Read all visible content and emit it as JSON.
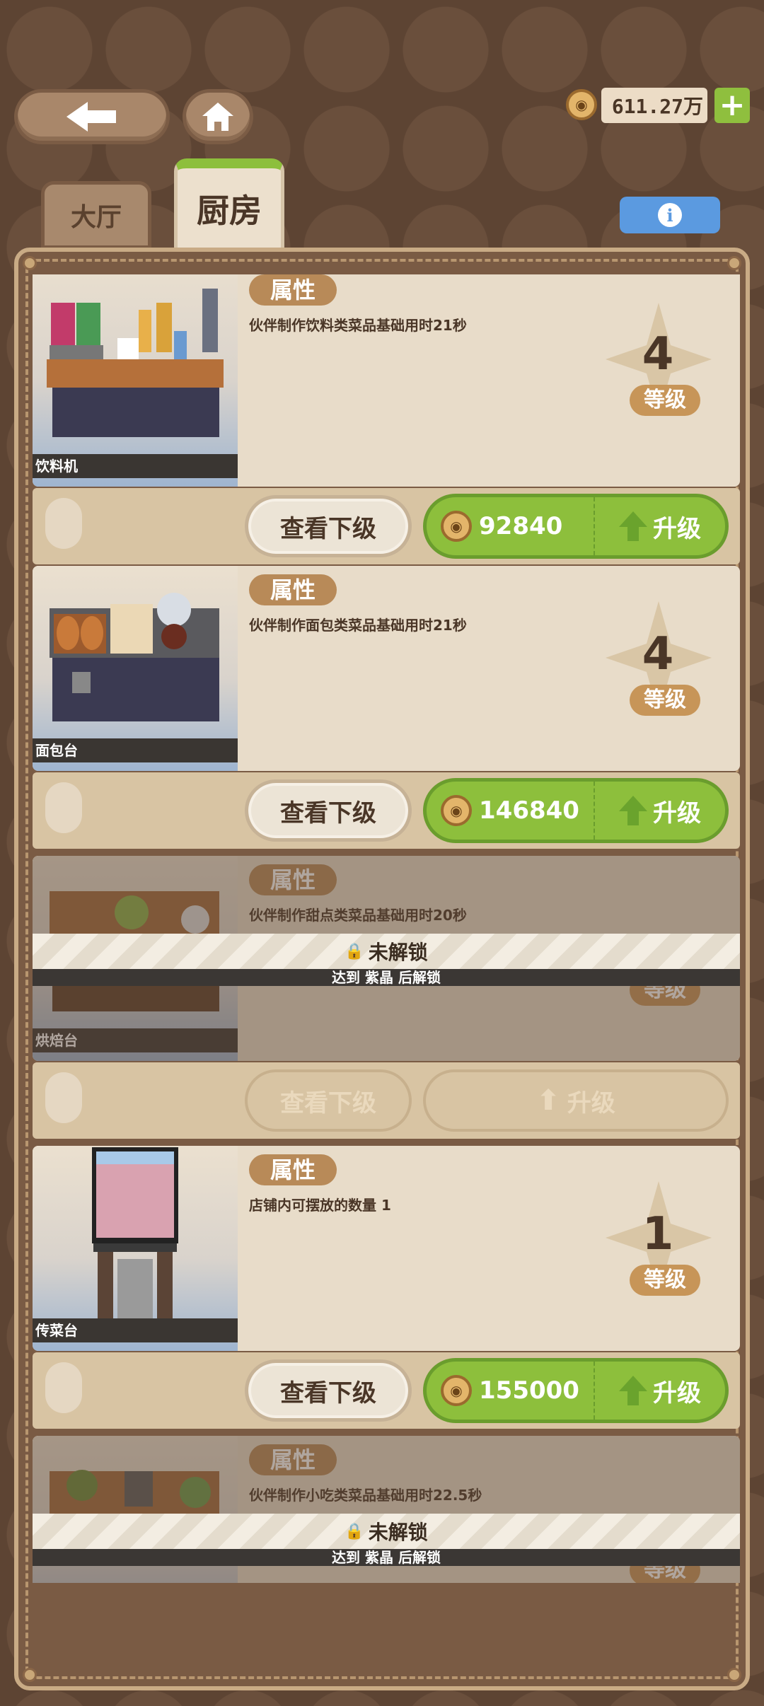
{
  "header": {
    "back_icon": "arrow-left-icon",
    "home_icon": "home-icon",
    "currency_value": "611.27万",
    "currency_icon": "coin-icon",
    "add_label": "+"
  },
  "tabs": [
    {
      "label": "大厅",
      "active": false
    },
    {
      "label": "厨房",
      "active": true
    }
  ],
  "info_label": "i",
  "items": [
    {
      "name": "饮料机",
      "attr_label": "属性",
      "desc": "伙伴制作饮料类菜品基础用时21秒",
      "level": "4",
      "level_label": "等级",
      "view_label": "查看下级",
      "cost": "92840",
      "upgrade_label": "升级",
      "locked": false
    },
    {
      "name": "面包台",
      "attr_label": "属性",
      "desc": "伙伴制作面包类菜品基础用时21秒",
      "level": "4",
      "level_label": "等级",
      "view_label": "查看下级",
      "cost": "146840",
      "upgrade_label": "升级",
      "locked": false
    },
    {
      "name": "烘焙台",
      "attr_label": "属性",
      "desc": "伙伴制作甜点类菜品基础用时20秒",
      "level": "",
      "level_label": "等级",
      "view_label": "查看下级",
      "cost": "",
      "upgrade_label": "升级",
      "locked": true,
      "lock_text": "未解锁",
      "unlock_condition": "达到 紫晶 后解锁"
    },
    {
      "name": "传菜台",
      "attr_label": "属性",
      "desc": "店铺内可摆放的数量 1",
      "level": "1",
      "level_label": "等级",
      "view_label": "查看下级",
      "cost": "155000",
      "upgrade_label": "升级",
      "locked": false
    },
    {
      "name": "",
      "attr_label": "属性",
      "desc": "伙伴制作小吃类菜品基础用时22.5秒",
      "level": "",
      "level_label": "等级",
      "view_label": "",
      "cost": "",
      "upgrade_label": "",
      "locked": true,
      "lock_text": "未解锁",
      "unlock_condition": "达到 紫晶 后解锁"
    }
  ],
  "colors": {
    "upgrade_green": "#8dbf3c",
    "info_blue": "#5b9ae0",
    "badge_brown": "#b88a58"
  }
}
